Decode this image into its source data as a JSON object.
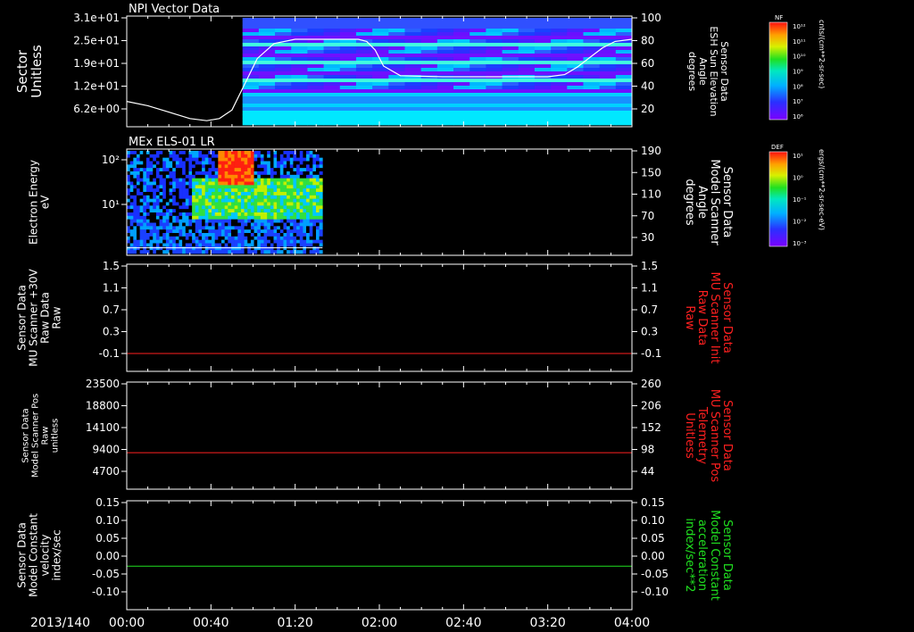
{
  "time_axis": {
    "date_label": "2013/140",
    "ticks": [
      "00:00",
      "00:40",
      "01:20",
      "02:00",
      "02:40",
      "03:20",
      "04:00"
    ],
    "range_minutes": [
      0,
      240
    ]
  },
  "chart_data": [
    {
      "type": "heatmap",
      "panel_title": "NPI Vector Data",
      "ylabel": [
        "Sector",
        "Unitless"
      ],
      "y_ticks": [
        "3.1e+01",
        "2.5e+01",
        "1.9e+01",
        "1.2e+01",
        "6.2e+00"
      ],
      "ylabel_right": [
        "Sensor Data",
        "ESH Sun Elevation",
        "Angle",
        "degrees"
      ],
      "y_ticks_right": [
        "100",
        "80",
        "60",
        "40",
        "20"
      ],
      "ylim_right": [
        0,
        100
      ],
      "colorbar": {
        "label": "NF",
        "unit": "cnts/(cm**2-sr-sec)",
        "ticks": [
          "10¹²",
          "10¹¹",
          "10¹⁰",
          "10⁹",
          "10⁸",
          "10⁷",
          "10⁶"
        ]
      },
      "data_start_minutes": 55,
      "line_series": {
        "x_minutes": [
          0,
          10,
          20,
          30,
          38,
          44,
          50,
          56,
          62,
          70,
          80,
          95,
          110,
          114,
          118,
          122,
          130,
          150,
          180,
          200,
          208,
          214,
          220,
          226,
          232,
          240
        ],
        "values": [
          22,
          18,
          12,
          6,
          4,
          6,
          14,
          38,
          62,
          76,
          80,
          80,
          80,
          78,
          70,
          55,
          46,
          45,
          45,
          45,
          47,
          54,
          63,
          72,
          78,
          80
        ]
      }
    },
    {
      "type": "heatmap",
      "panel_title": "MEx ELS-01 LR",
      "ylabel": [
        "Electron Energy",
        "eV"
      ],
      "y_ticks": [
        "10²",
        "10¹"
      ],
      "ylabel_right": [
        "Sensor Data",
        "Model Scanner",
        "Angle",
        "degrees"
      ],
      "y_ticks_right": [
        "190",
        "150",
        "110",
        "70",
        "30"
      ],
      "colorbar": {
        "label": "DEF",
        "unit": "ergs/(cm**2-sr-sec-eV)",
        "ticks": [
          "10¹",
          "10⁰",
          "10⁻¹",
          "10⁻²",
          "10⁻³"
        ]
      },
      "data_range_minutes": [
        0,
        93
      ],
      "hot_spot_minutes": [
        43,
        60
      ],
      "line_series": {
        "x_minutes": [
          0,
          93
        ],
        "values": [
          20,
          20
        ]
      }
    },
    {
      "type": "line",
      "ylabel": [
        "Sensor Data",
        "MU Scanner +30V",
        "Raw Data",
        "Raw"
      ],
      "y_ticks": [
        "1.5",
        "1.1",
        "0.7",
        "0.3",
        "-0.1"
      ],
      "ylim": [
        -0.3,
        1.5
      ],
      "ylabel_right": [
        "Sensor Data",
        "MU Scanner Init",
        "Raw Data",
        "Raw"
      ],
      "y_ticks_right": [
        "1.5",
        "1.1",
        "0.7",
        "0.3",
        "-0.1"
      ],
      "series": [
        {
          "color": "#ff2020",
          "values": [
            0.0,
            0.0
          ]
        }
      ]
    },
    {
      "type": "line",
      "ylabel": [
        "Sensor Data",
        "Model Scanner Pos",
        "Raw",
        "unitless"
      ],
      "y_ticks": [
        "23500",
        "18800",
        "14100",
        "9400",
        "4700"
      ],
      "ylim": [
        0,
        23500
      ],
      "ylabel_right": [
        "Sensor Data",
        "MU Scanner Pos",
        "Telemetry",
        "Unitless"
      ],
      "y_ticks_right": [
        "260",
        "206",
        "152",
        "98",
        "44"
      ],
      "series": [
        {
          "color": "#ff2020",
          "values": [
            8000,
            8000
          ]
        }
      ]
    },
    {
      "type": "line",
      "ylabel": [
        "Sensor Data",
        "Model Constant",
        "velocity",
        "index/sec"
      ],
      "y_ticks": [
        "0.15",
        "0.10",
        "0.05",
        "0.00",
        "-0.05",
        "-0.10"
      ],
      "ylim": [
        -0.1,
        0.15
      ],
      "ylabel_right": [
        "Sensor Data",
        "Model Constant",
        "acceleration",
        "index/sec**2"
      ],
      "y_ticks_right": [
        "0.15",
        "0.10",
        "0.05",
        "0.00",
        "-0.05",
        "-0.10"
      ],
      "series": [
        {
          "color": "#20e020",
          "values": [
            0.0,
            0.0
          ]
        }
      ]
    }
  ],
  "colors": {
    "axis": "#ffffff",
    "red_label": "#ff2020",
    "green_label": "#20e020"
  }
}
